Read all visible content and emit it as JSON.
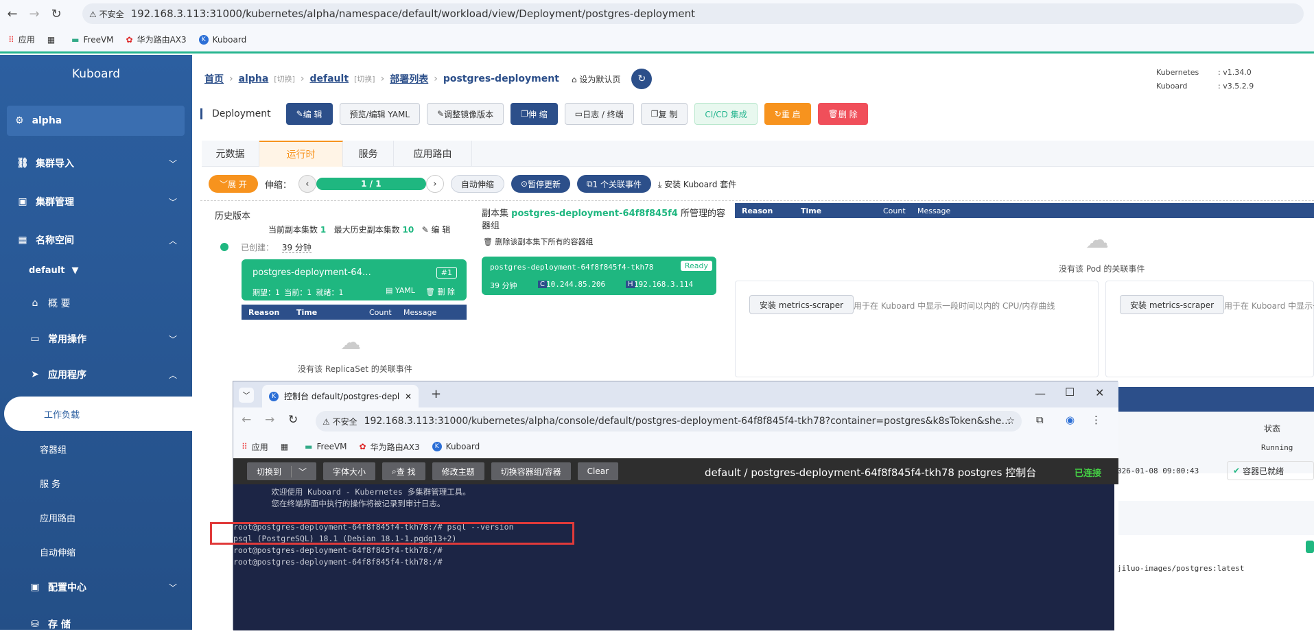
{
  "browser": {
    "warn": "⚠ 不安全",
    "url": "192.168.3.113:31000/kubernetes/alpha/namespace/default/workload/view/Deployment/postgres-deployment",
    "bookmarks": [
      "应用",
      "FreeVM",
      "华为路由AX3",
      "Kuboard"
    ]
  },
  "sidebar": {
    "brand": "Kuboard",
    "cluster": "alpha",
    "items": [
      "集群导入",
      "集群管理",
      "名称空间"
    ],
    "namespace": "default",
    "overview": "概 要",
    "common_ops": "常用操作",
    "apps": "应用程序",
    "subitems": [
      "工作负载",
      "容器组",
      "服 务",
      "应用路由",
      "自动伸缩"
    ],
    "config": "配置中心",
    "storage": "存 储"
  },
  "breadcrumb": {
    "home": "首页",
    "cluster": "alpha",
    "switch1": "[切换]",
    "ns": "default",
    "switch2": "[切换]",
    "list": "部署列表",
    "current": "postgres-deployment",
    "default_page": "设为默认页"
  },
  "versions": [
    {
      "name": "Kubernetes",
      "value": ": v1.34.0"
    },
    {
      "name": "Kuboard",
      "value": ": v3.5.2.9"
    }
  ],
  "toolbar": {
    "title": "Deployment",
    "buttons": [
      "编 辑",
      "预览/编辑 YAML",
      "调整镜像版本",
      "伸 缩",
      "日志 / 终端",
      "复 制",
      "CI/CD 集成",
      "重 启",
      "删 除"
    ]
  },
  "tabs": [
    "元数据",
    "运行时",
    "服务",
    "应用路由"
  ],
  "controls": {
    "expand": "展 开",
    "scale_label": "伸缩：",
    "scale_value": "1 / 1",
    "autoscale": "自动伸缩",
    "pause": "暂停更新",
    "events": "1 个关联事件",
    "install": "安装 Kuboard 套件"
  },
  "history": {
    "title": "历史版本",
    "current_label": "当前副本集数",
    "current_value": "1",
    "max_label": "最大历史副本集数",
    "max_value": "10",
    "edit": "编 辑",
    "created_label": "已创建：",
    "created_value": "39 分钟",
    "rs_name": "postgres-deployment-64…",
    "rs_tag": "#1",
    "rs_stats": "期望：1 当前：1 就绪：1",
    "yaml": "YAML",
    "delete": "删 除",
    "no_events": "没有该 ReplicaSet 的关联事件"
  },
  "event_cols": [
    "Reason",
    "Time",
    "Count",
    "Message"
  ],
  "replicaset": {
    "prefix": "副本集",
    "name": "postgres-deployment-64f8f845f4",
    "suffix": "所管理的容器组",
    "delete_pods": "删除该副本集下所有的容器组",
    "pod": "postgres-deployment-64f8f845f4-tkh78",
    "status": "Ready",
    "age": "39 分钟",
    "pod_ip": "10.244.85.206",
    "host_ip": "192.168.3.114"
  },
  "pod_events": {
    "empty": "没有该 Pod 的关联事件"
  },
  "metrics": {
    "btn": "安装 metrics-scraper",
    "desc": "用于在 Kuboard 中显示一段时间以内的 CPU/内存曲线",
    "desc2": "用于在 Kuboard 中显示一"
  },
  "console": {
    "tab_title": "控制台 default/postgres-depl",
    "url": "192.168.3.113:31000/kubernetes/alpha/console/default/postgres-deployment-64f8f845f4-tkh78?container=postgres&k8sToken&she…",
    "warn": "⚠ 不安全",
    "bookmarks": [
      "应用",
      "FreeVM",
      "华为路由AX3",
      "Kuboard"
    ],
    "tools": [
      "切换到",
      "字体大小",
      "查 找",
      "修改主题",
      "切换容器组/容器",
      "Clear"
    ],
    "heading": "default / postgres-deployment-64f8f845f4-tkh78 postgres 控制台",
    "status": "已连接",
    "lines": [
      "        欢迎使用 Kuboard - Kubernetes 多集群管理工具。",
      "        您在终端界面中执行的操作将被记录到审计日志。",
      "",
      "root@postgres-deployment-64f8f845f4-tkh78:/# psql --version",
      "psql (PostgreSQL) 18.1 (Debian 18.1-1.pgdg13+2)",
      "root@postgres-deployment-64f8f845f4-tkh78:/#",
      "root@postgres-deployment-64f8f845f4-tkh78:/#"
    ]
  },
  "peek": {
    "status_head": "状态",
    "running": "Running",
    "time": "026-01-08 09:00:43",
    "ready": "容器已就绪",
    "image": "jiluo-images/postgres:latest"
  }
}
